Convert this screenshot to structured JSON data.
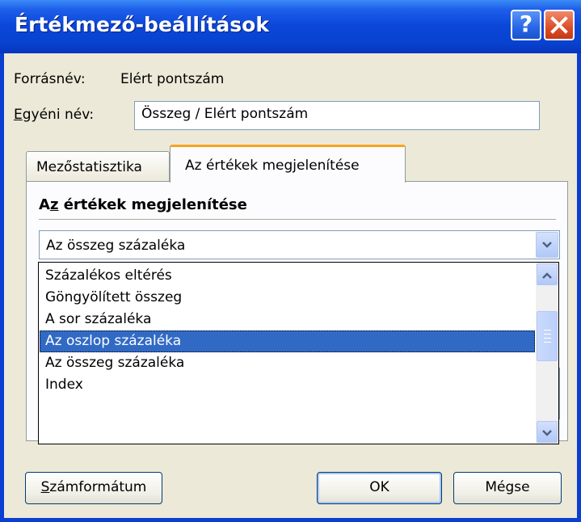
{
  "window": {
    "title": "Értékmező-beállítások"
  },
  "source": {
    "label": "Forrásnév:",
    "value": "Elért pontszám"
  },
  "custom_name": {
    "label_first": "E",
    "label_rest": "gyéni név:",
    "value": "Összeg / Elért pontszám"
  },
  "tabs": [
    {
      "label": "Mezőstatisztika"
    },
    {
      "label": "Az értékek megjelenítése"
    }
  ],
  "section": {
    "title_a": "A",
    "title_z": "z",
    "title_rest": " értékek megjelenítése"
  },
  "display_as": {
    "selected": "Az összeg százaléka",
    "options": [
      "Százalékos eltérés",
      "Göngyölített összeg",
      "A sor százaléka",
      "Az oszlop százaléka",
      "Az összeg százaléka",
      "Index"
    ],
    "highlighted_index": 3
  },
  "buttons": {
    "number_format_first": "S",
    "number_format_rest": "zámformátum",
    "ok": "OK",
    "cancel": "Mégse"
  },
  "colors": {
    "title_bar": "#0a46d8",
    "dialog_bg": "#ece9d8",
    "selection": "#316ac5",
    "tab_highlight": "#f7a31d"
  },
  "icons": {
    "help": "help-icon",
    "close": "close-icon",
    "dropdown": "chevron-down-icon",
    "scroll_up": "chevron-up-icon",
    "scroll_down": "chevron-down-icon"
  }
}
